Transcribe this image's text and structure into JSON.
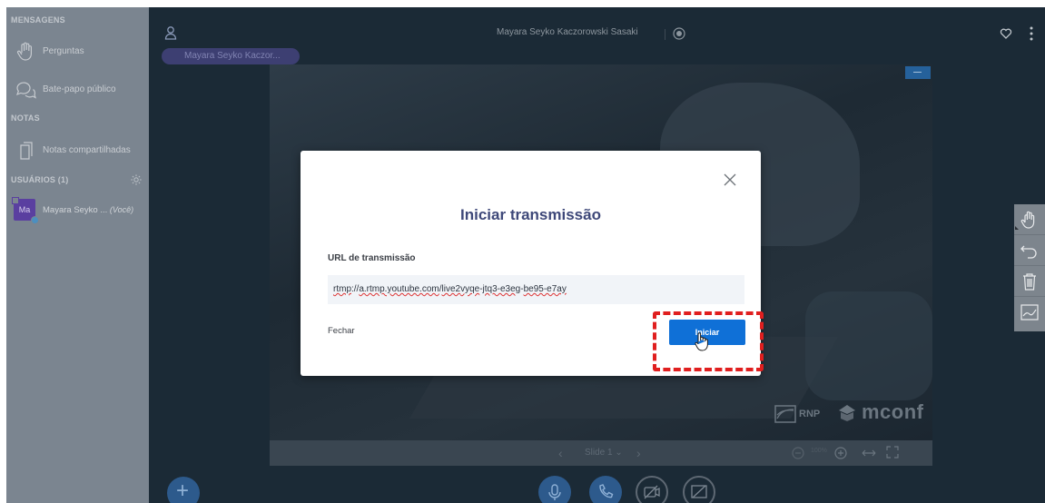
{
  "sidebar": {
    "sections": {
      "messages": "MENSAGENS",
      "notes": "NOTAS",
      "users": "USUÁRIOS (1)"
    },
    "items": {
      "questions": "Perguntas",
      "public_chat": "Bate-papo público",
      "shared_notes": "Notas compartilhadas"
    },
    "user": {
      "avatar_initials": "Ma",
      "name": "Mayara Seyko ... ",
      "you_label": "(Você)"
    }
  },
  "header": {
    "meeting_title": "Mayara Seyko Kaczorowski Sasaki",
    "presenter_tag": "Mayara Seyko Kaczor..."
  },
  "slide": {
    "rnp_logo_text": "RNP",
    "mconf_logo_text": "mconf",
    "toolbar": {
      "prev_glyph": "‹",
      "slide_label": "Slide 1",
      "next_glyph": "›",
      "zoom_level": "100%"
    }
  },
  "modal": {
    "title": "Iniciar transmissão",
    "url_label": "URL de transmissão",
    "url_prefix": "rtmp",
    "url_sep1": "://",
    "url_part2": "a.rtmp.youtube.com",
    "url_sep2": "/",
    "url_part3": "live2",
    "url_part4": "vyqe",
    "url_sep3": "-",
    "url_part5": "jtq3-e3eg",
    "url_sep4": "-",
    "url_part6": "be95-e7ay",
    "close_label": "Fechar",
    "start_label": "Iniciar"
  },
  "colors": {
    "sidebar_bg": "#7b8590",
    "app_bg": "#1b2a36",
    "primary_button": "#0f70d7",
    "highlight": "#e01f1f",
    "modal_title": "#3e4879"
  },
  "icons": {
    "hand": "hand-icon",
    "chat": "chat-bubbles-icon",
    "notes": "document-icon",
    "gear": "gear-icon",
    "user": "person-icon",
    "record": "record-icon",
    "heart": "heart-icon",
    "menu": "vertical-dots-icon",
    "close": "close-icon",
    "cursor": "pointer-hand-icon"
  }
}
